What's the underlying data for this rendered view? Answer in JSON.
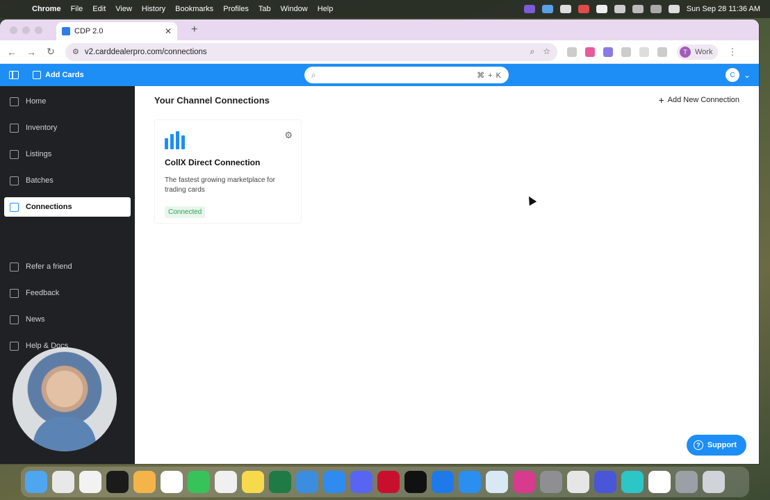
{
  "menubar": {
    "app_name": "Chrome",
    "menus": [
      "File",
      "Edit",
      "View",
      "History",
      "Bookmarks",
      "Profiles",
      "Tab",
      "Window",
      "Help"
    ],
    "clock": "Sun Sep 28  11:36 AM"
  },
  "browser": {
    "tab_title": "CDP 2.0",
    "url": "v2.carddealerpro.com/connections",
    "profile_label": "Work",
    "profile_initial": "T"
  },
  "app": {
    "add_cards_label": "Add Cards",
    "search_shortcut": "⌘ + K",
    "user_initial": "C"
  },
  "sidebar": {
    "items": [
      {
        "label": "Home",
        "icon": "home-icon"
      },
      {
        "label": "Inventory",
        "icon": "tag-icon"
      },
      {
        "label": "Listings",
        "icon": "cart-icon"
      },
      {
        "label": "Batches",
        "icon": "box-icon"
      },
      {
        "label": "Connections",
        "icon": "grid-icon",
        "active": true
      }
    ],
    "secondary": [
      {
        "label": "Refer a friend",
        "icon": "gift-icon"
      },
      {
        "label": "Feedback",
        "icon": "feedback-icon"
      },
      {
        "label": "News",
        "icon": "news-icon"
      },
      {
        "label": "Help & Docs",
        "icon": "help-icon"
      }
    ]
  },
  "main": {
    "title": "Your Channel Connections",
    "add_connection_label": "Add New Connection",
    "card": {
      "name": "CollX Direct Connection",
      "description": "The fastest growing marketplace for trading cards",
      "status": "Connected",
      "status_color": "#2ea155"
    }
  },
  "support_label": "Support",
  "colors": {
    "accent": "#1d8ef5",
    "sidebar_bg": "#1f2125"
  }
}
